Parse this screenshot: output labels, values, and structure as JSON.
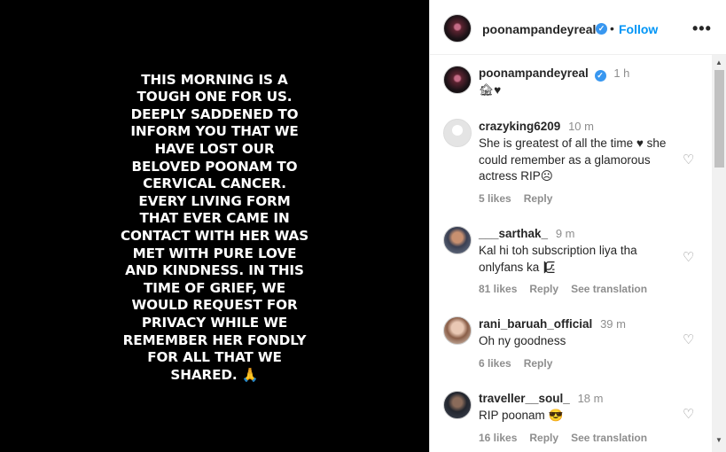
{
  "story": {
    "lines": [
      "THIS MORNING IS A",
      "TOUGH ONE FOR US.",
      "DEEPLY SADDENED TO",
      "INFORM YOU THAT WE",
      "HAVE LOST OUR",
      "BELOVED POONAM TO",
      "CERVICAL CANCER.",
      "EVERY LIVING FORM",
      "THAT EVER CAME IN",
      "CONTACT WITH HER WAS",
      "MET WITH PURE LOVE",
      "AND KINDNESS. IN THIS",
      "TIME OF GRIEF, WE",
      "WOULD REQUEST FOR",
      "PRIVACY WHILE WE",
      "REMEMBER HER FONDLY",
      "FOR ALL THAT WE"
    ],
    "last_line": "SHARED.",
    "emoji": "🙏"
  },
  "header": {
    "username": "poonampandeyreal",
    "verified_icon": "✓",
    "separator": "•",
    "follow_label": "Follow",
    "more_label": "•••"
  },
  "caption": {
    "username": "poonampandeyreal",
    "time": "1 h",
    "text": "🏚♥"
  },
  "comments": [
    {
      "username": "crazyking6209",
      "time": "10 m",
      "text": "She is greatest of all the time ♥ she could remember as a glamorous actress RIP☹",
      "likes": "5 likes",
      "reply": "Reply",
      "translation": ""
    },
    {
      "username": "___sarthak_",
      "time": "9 m",
      "text": "Kal hi toh subscription liya tha onlyfans ka 🯁",
      "likes": "81 likes",
      "reply": "Reply",
      "translation": "See translation"
    },
    {
      "username": "rani_baruah_official",
      "time": "39 m",
      "text": "Oh ny goodness",
      "likes": "6 likes",
      "reply": "Reply",
      "translation": ""
    },
    {
      "username": "traveller__soul_",
      "time": "18 m",
      "text": "RIP poonam 😎",
      "likes": "16 likes",
      "reply": "Reply",
      "translation": "See translation"
    }
  ],
  "icons": {
    "heart": "♡",
    "scroll_up": "▲",
    "scroll_down": "▼"
  },
  "colors": {
    "accent": "#0095f6",
    "verified": "#3897f0",
    "muted": "#8e8e8e"
  }
}
